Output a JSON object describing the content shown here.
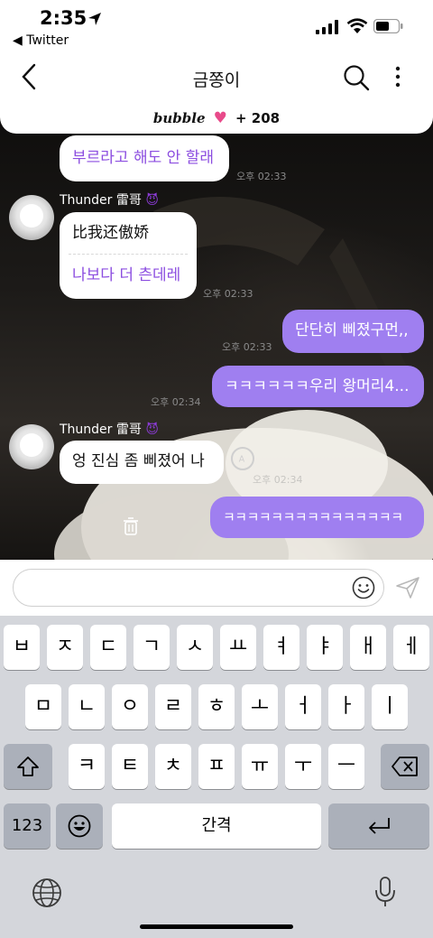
{
  "status_bar": {
    "time": "2:35",
    "back_app": "◀ Twitter"
  },
  "header": {
    "title": "금쫑이"
  },
  "bubble_bar": {
    "brand": "bubble",
    "count": "+ 208"
  },
  "messages": [
    {
      "text": "부르라고 해도 안 할래",
      "time": "오후 02:33"
    },
    {
      "sender": "Thunder 雷哥",
      "line1": "比我还傲娇",
      "line2": "나보다 더 츤데레",
      "time": "오후 02:33"
    },
    {
      "text": "단단히 삐졌구먼,,",
      "time": "오후 02:33"
    },
    {
      "text": "ㅋㅋㅋㅋㅋㅋ우리 왕머리4...",
      "time": "오후 02:34"
    },
    {
      "sender": "Thunder 雷哥",
      "text": "엉 진심 좀 삐졌어 나",
      "time": "오후 02:34"
    },
    {
      "text": "ㅋㅋㅋㅋㅋㅋㅋㅋㅋㅋㅋㅋㅋㅋㅋ"
    }
  ],
  "keyboard": {
    "row1": [
      "ㅂ",
      "ㅈ",
      "ㄷ",
      "ㄱ",
      "ㅅ",
      "ㅛ",
      "ㅕ",
      "ㅑ",
      "ㅐ",
      "ㅔ"
    ],
    "row2": [
      "ㅁ",
      "ㄴ",
      "ㅇ",
      "ㄹ",
      "ㅎ",
      "ㅗ",
      "ㅓ",
      "ㅏ",
      "ㅣ"
    ],
    "row3": [
      "ㅋ",
      "ㅌ",
      "ㅊ",
      "ㅍ",
      "ㅠ",
      "ㅜ",
      "ㅡ"
    ],
    "numbers_label": "123",
    "space_label": "간격"
  },
  "colors": {
    "purple_bubble": "#9f7ff0",
    "korean_text": "#8c4ee0",
    "heart": "#e84a8a"
  }
}
